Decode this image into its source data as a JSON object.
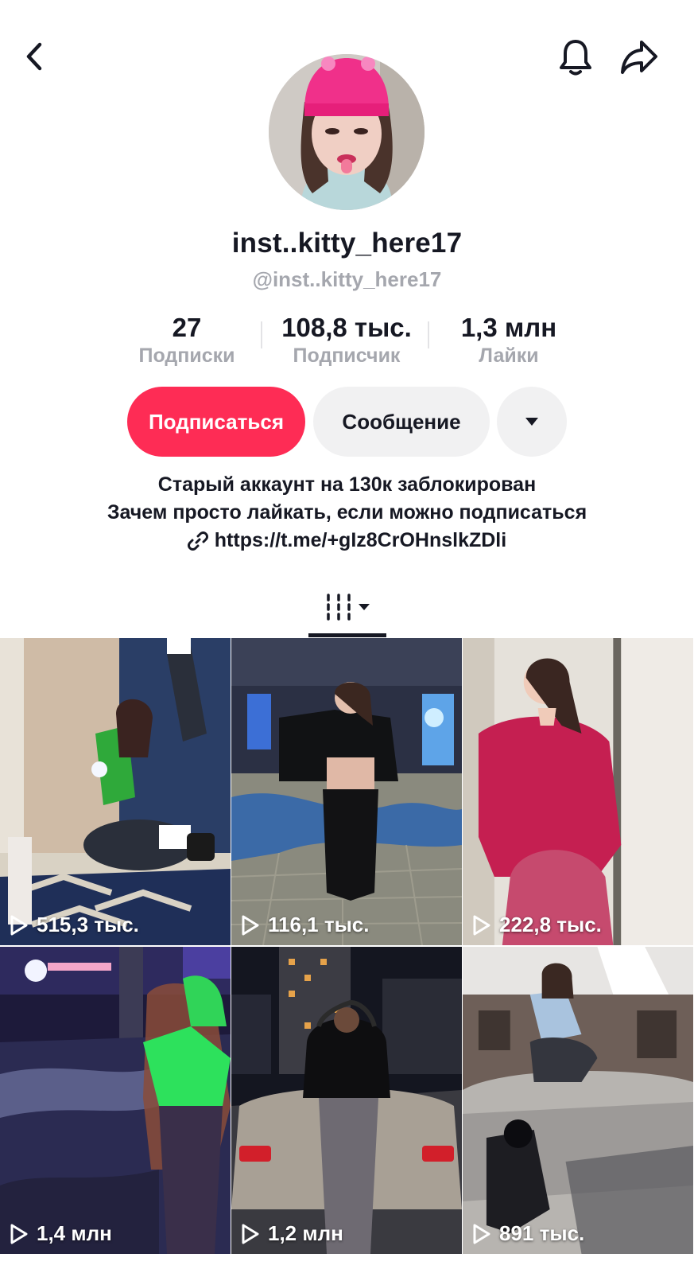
{
  "profile": {
    "display_name": "inst..kitty_here17",
    "handle": "@inst..kitty_here17"
  },
  "stats": {
    "following": {
      "value": "27",
      "label": "Подписки"
    },
    "followers": {
      "value": "108,8 тыс.",
      "label": "Подписчик"
    },
    "likes": {
      "value": "1,3 млн",
      "label": "Лайки"
    }
  },
  "actions": {
    "follow_label": "Подписаться",
    "message_label": "Сообщение"
  },
  "bio": {
    "line1": "Старый аккаунт на 130к заблокирован",
    "line2": "Зачем просто лайкать, если можно подписаться",
    "link": "https://t.me/+gIz8CrOHnslkZDli"
  },
  "icons": {
    "back": "chevron-left-icon",
    "bell": "bell-icon",
    "share": "share-arrow-icon",
    "more": "caret-down-icon",
    "link": "link-icon",
    "grid": "grid-icon",
    "play": "play-outline-icon"
  },
  "colors": {
    "accent": "#fe2c55",
    "secondary_button": "#f1f1f2",
    "muted_text": "#a5a7ae"
  },
  "videos": [
    {
      "views": "515,3 тыс."
    },
    {
      "views": "116,1 тыс."
    },
    {
      "views": "222,8 тыс."
    },
    {
      "views": "1,4 млн"
    },
    {
      "views": "1,2 млн"
    },
    {
      "views": "891 тыс."
    }
  ]
}
